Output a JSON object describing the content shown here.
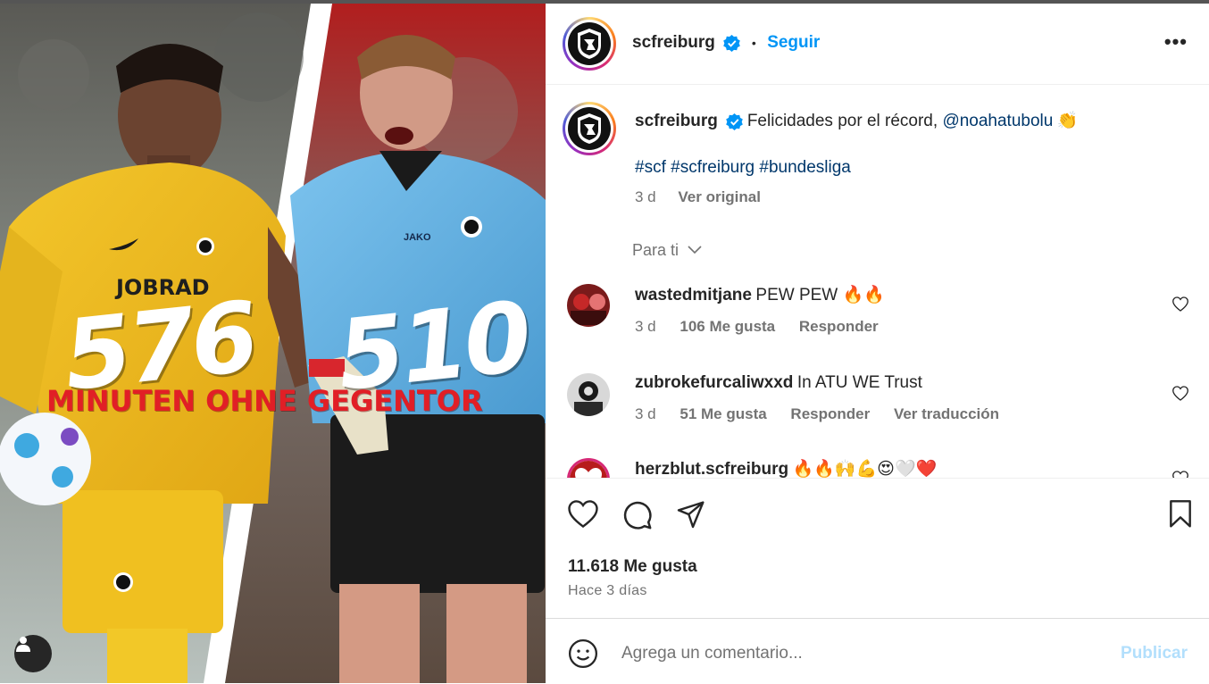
{
  "post": {
    "username": "scfreiburg",
    "follow_label": "Seguir",
    "more_label": "•••",
    "image": {
      "sponsor": "JOBRAD",
      "kit_brand": "JAKO",
      "stat_left": "576",
      "stat_right": "510",
      "banner": "MINUTEN OHNE GEGENTOR"
    }
  },
  "caption": {
    "username": "scfreiburg",
    "text": "Felicidades por el récord, ",
    "mention": "@noahatubolu",
    "emoji": "👏",
    "hashtags": "#scf #scfreiburg #bundesliga",
    "time": "3 d",
    "translate": "Ver original"
  },
  "for_you_label": "Para ti",
  "comments": [
    {
      "user": "wastedmitjane",
      "text": "PEW PEW 🔥🔥",
      "time": "3 d",
      "likes": "106 Me gusta",
      "reply": "Responder",
      "avatar_colors": [
        "#7a1b1b",
        "#c62828"
      ]
    },
    {
      "user": "zubrokefurcaliwxxd",
      "text": "In ATU WE Trust",
      "time": "3 d",
      "likes": "51 Me gusta",
      "reply": "Responder",
      "translate": "Ver traducción",
      "avatar_colors": [
        "#1a1a1a",
        "#e0e0e0"
      ]
    },
    {
      "user": "herzblut.scfreiburg",
      "text": "🔥🔥🙌💪😍🤍❤️",
      "avatar_colors": [
        "#b71c1c",
        "#ffffff"
      ]
    }
  ],
  "footer": {
    "likes": "11.618 Me gusta",
    "when": "Hace 3 días",
    "comment_placeholder": "Agrega un comentario...",
    "publish_label": "Publicar"
  },
  "colors": {
    "accent": "#0095f6",
    "link": "#00376b",
    "secondary_text": "#737373",
    "publish_disabled": "#b2dffc",
    "banner_red": "#e11f26"
  }
}
